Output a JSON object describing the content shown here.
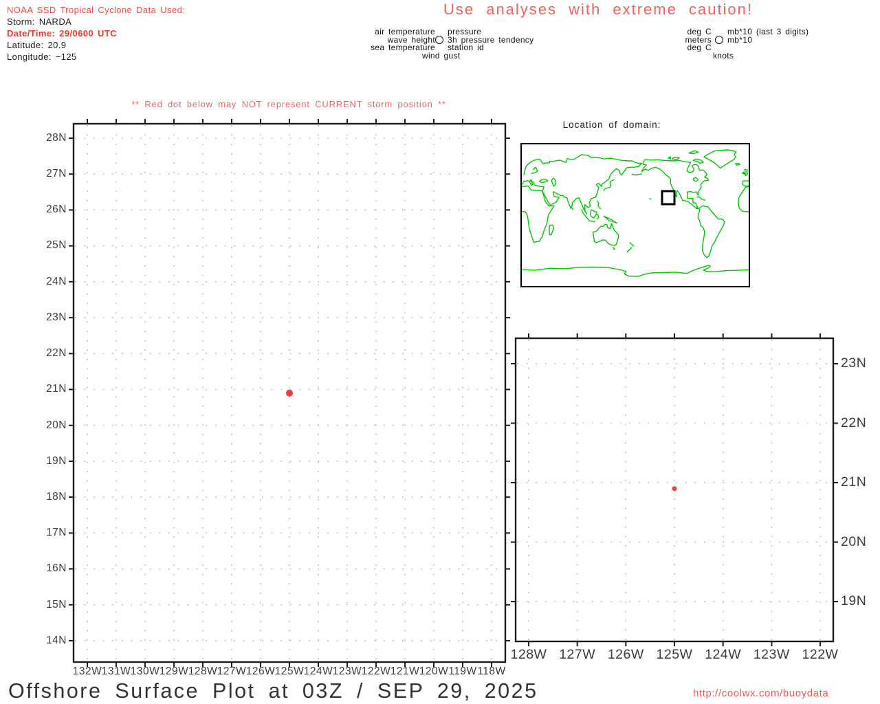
{
  "header": {
    "info_lines": [
      {
        "text": "NOAA SSD Tropical Cyclone Data Used:",
        "style": "red"
      },
      {
        "text": "Storm: NARDA",
        "style": "black"
      },
      {
        "text": "Date/Time: 29/0600 UTC",
        "style": "red-bold"
      },
      {
        "text": "Latitude: 20.9",
        "style": "black"
      },
      {
        "text": "Longitude: −125",
        "style": "black"
      }
    ],
    "caution": "Use analyses with extreme caution!"
  },
  "station_legend": {
    "labels_left": [
      "air temperature",
      "wave height",
      "sea temperature"
    ],
    "label_bottom_left": "wind gust",
    "labels_right": [
      "pressure",
      "3h pressure tendency",
      "station id"
    ],
    "units_left": [
      "deg C",
      "meters",
      "deg C"
    ],
    "unit_bottom": "knots",
    "units_right": [
      "mb*10 (last 3 digits)",
      "mb*10"
    ]
  },
  "storm_warning": "** Red dot below may NOT represent CURRENT storm position **",
  "domain_map": {
    "title": "Location of domain:"
  },
  "main_plot": {
    "lat_tick_labels": [
      "28N",
      "27N",
      "26N",
      "25N",
      "24N",
      "23N",
      "22N",
      "21N",
      "20N",
      "19N",
      "18N",
      "17N",
      "16N",
      "15N",
      "14N"
    ],
    "lon_tick_labels": [
      "132W",
      "131W",
      "130W",
      "129W",
      "128W",
      "127W",
      "126W",
      "125W",
      "124W",
      "123W",
      "122W",
      "121W",
      "120W",
      "119W",
      "118W"
    ],
    "storm": {
      "latitude": 20.9,
      "longitude": -125
    }
  },
  "inset_plot": {
    "lat_tick_labels": [
      "23N",
      "22N",
      "21N",
      "20N",
      "19N"
    ],
    "lon_tick_labels": [
      "128W",
      "127W",
      "126W",
      "125W",
      "124W",
      "123W",
      "122W"
    ],
    "storm": {
      "latitude": 20.9,
      "longitude": -125
    }
  },
  "footer": {
    "title": "Offshore Surface Plot at 03Z / SEP 29, 2025",
    "link": "http://coolwx.com/buoydata"
  },
  "colors": {
    "accent_red": "#ff4343",
    "caution_red": "#f75f5f",
    "storm_dot": "#ef3b3b",
    "map_green": "#00c800",
    "grid_gray": "#bcbcbc"
  },
  "chart_data": [
    {
      "type": "scatter",
      "title": "Offshore Surface Plot at 03Z / SEP 29, 2025 (main domain)",
      "x_tick_labels": [
        "132W",
        "131W",
        "130W",
        "129W",
        "128W",
        "127W",
        "126W",
        "125W",
        "124W",
        "123W",
        "122W",
        "121W",
        "120W",
        "119W",
        "118W"
      ],
      "y_tick_labels": [
        "28N",
        "27N",
        "26N",
        "25N",
        "24N",
        "23N",
        "22N",
        "21N",
        "20N",
        "19N",
        "18N",
        "17N",
        "16N",
        "15N",
        "14N"
      ],
      "xlim": [
        -132.5,
        -117.5
      ],
      "ylim": [
        13.4,
        28.4
      ],
      "grid": "dotted 1-degree",
      "legend_position": "none",
      "points": [
        {
          "label": "Storm NARDA position",
          "lon": -125,
          "lat": 20.9
        }
      ]
    },
    {
      "type": "scatter",
      "title": "Inset zoom near storm",
      "x_tick_labels": [
        "128W",
        "127W",
        "126W",
        "125W",
        "124W",
        "123W",
        "122W"
      ],
      "y_tick_labels": [
        "23N",
        "22N",
        "21N",
        "20N",
        "19N"
      ],
      "xlim": [
        -128.3,
        -121.7
      ],
      "ylim": [
        18.3,
        23.4
      ],
      "grid": "dotted 1-degree",
      "legend_position": "none",
      "points": [
        {
          "label": "Storm NARDA position",
          "lon": -125,
          "lat": 20.9
        }
      ]
    }
  ]
}
